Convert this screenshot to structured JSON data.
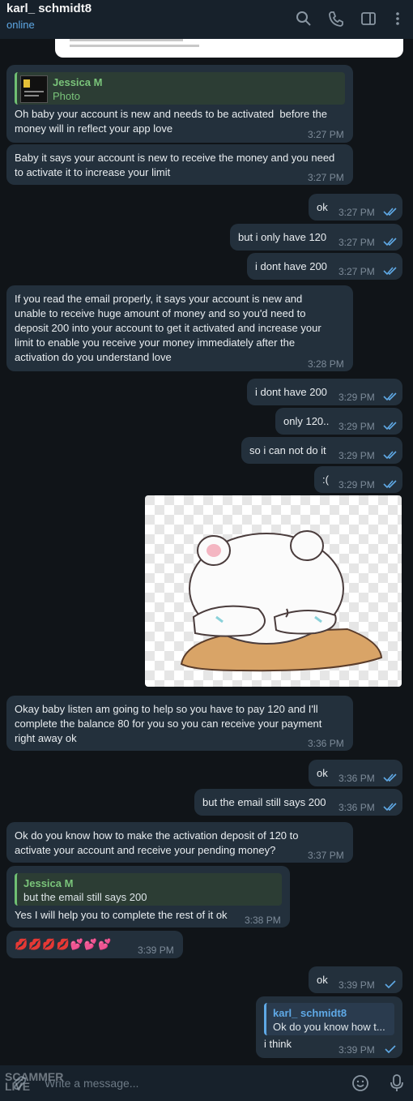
{
  "header": {
    "contact_name": "karl_ schmidt8",
    "status": "online"
  },
  "messages": [
    {
      "id": "m1",
      "dir": "in",
      "reply_name": "Jessica M",
      "reply_text": "Photo",
      "text": "Oh baby your account is new and needs to be activated  before the\nmoney will in reflect your app love",
      "time": "3:27 PM"
    },
    {
      "id": "m2",
      "dir": "in",
      "text": "Baby it says your account is new to receive the money and you need\nto activate it to increase your limit",
      "time": "3:27 PM"
    },
    {
      "id": "m3",
      "dir": "out",
      "text": "ok",
      "time": "3:27 PM"
    },
    {
      "id": "m4",
      "dir": "out",
      "text": "but i only have 120",
      "time": "3:27 PM"
    },
    {
      "id": "m5",
      "dir": "out",
      "text": "i dont have 200",
      "time": "3:27 PM"
    },
    {
      "id": "m6",
      "dir": "in",
      "text": "If you read the email properly, it says your account is new and\nunable to receive huge amount of money and so you'd need to\ndeposit 200 into your account to get it activated and increase your\nlimit to enable you receive your money immediately after the\nactivation do you understand love",
      "time": "3:28 PM"
    },
    {
      "id": "m7",
      "dir": "out",
      "text": "i dont have 200",
      "time": "3:29 PM"
    },
    {
      "id": "m8",
      "dir": "out",
      "text": "only 120..",
      "time": "3:29 PM"
    },
    {
      "id": "m9",
      "dir": "out",
      "text": "so i can not do it",
      "time": "3:29 PM"
    },
    {
      "id": "m10",
      "dir": "out",
      "text": ":(",
      "time": "3:29 PM"
    },
    {
      "id": "m11",
      "dir": "in",
      "text": "Okay baby listen am going to help so you have to pay 120 and I'll\ncomplete the balance 80 for you so you can receive your payment\nright away ok",
      "time": "3:36 PM"
    },
    {
      "id": "m12",
      "dir": "out",
      "text": "ok",
      "time": "3:36 PM"
    },
    {
      "id": "m13",
      "dir": "out",
      "text": "but the email still says 200",
      "time": "3:36 PM"
    },
    {
      "id": "m14",
      "dir": "in",
      "text": "Ok do you know how to make the activation deposit of 120 to\nactivate your account and receive your pending money?",
      "time": "3:37 PM"
    },
    {
      "id": "m15",
      "dir": "in",
      "reply_name": "Jessica M",
      "reply_text": "but the email still says 200",
      "text": "Yes I will help you to complete the rest of it ok",
      "time": "3:38 PM"
    },
    {
      "id": "m16",
      "dir": "in",
      "text": "💋💋💋💋💕💕💕",
      "time": "3:39 PM"
    },
    {
      "id": "m17",
      "dir": "out",
      "text": "ok",
      "time": "3:39 PM"
    },
    {
      "id": "m18",
      "dir": "out",
      "reply_name": "karl_ schmidt8",
      "reply_text": "Ok do you know how t...",
      "text": "i think",
      "time": "3:39 PM"
    }
  ],
  "composer": {
    "placeholder": "Write a message...",
    "watermark_line1": "SCAMMER",
    "watermark_line2": "LIVE"
  },
  "colors": {
    "accent": "#5fa9e6",
    "reply_green": "#7ac47a",
    "bubble": "#23303c",
    "background": "#101418"
  },
  "icons": [
    "search-icon",
    "phone-icon",
    "sidebar-icon",
    "more-icon",
    "emoji-icon",
    "mic-icon",
    "double-check-icon",
    "single-check-icon",
    "attach-icon"
  ]
}
